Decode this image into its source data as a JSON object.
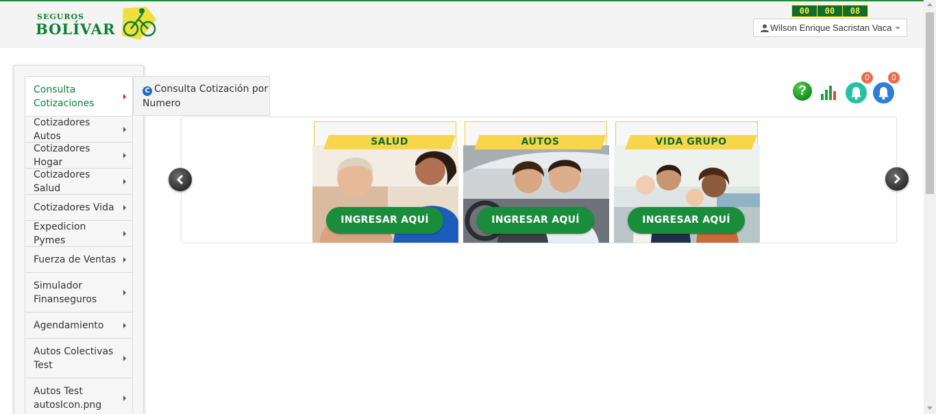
{
  "header": {
    "logo_small": "SEGUROS",
    "logo_big": "BOLÍVAR",
    "timer": [
      "00",
      "00",
      "08"
    ],
    "user_name": "Wilson Enrique Sacristan Vaca"
  },
  "colors": {
    "brand_green": "#0e7f37",
    "accent_yellow": "#f7d64a",
    "badge_orange": "#ee6a4d"
  },
  "sidebar": {
    "items": [
      {
        "label": "Consulta Cotizaciones",
        "active": true
      },
      {
        "label": "Cotizadores Autos"
      },
      {
        "label": "Cotizadores Hogar"
      },
      {
        "label": "Cotizadores Salud"
      },
      {
        "label": "Cotizadores Vida"
      },
      {
        "label": "Expedicion Pymes"
      },
      {
        "label": "Fuerza de Ventas"
      },
      {
        "label": "Simulador Finanseguros"
      },
      {
        "label": "Agendamiento"
      },
      {
        "label": "Autos Colectivas Test"
      },
      {
        "label": "Autos Test autosIcon.png"
      }
    ]
  },
  "submenu": {
    "icon_letter": "C",
    "label": "Consulta Cotización por Numero"
  },
  "toolbar": {
    "help_symbol": "?",
    "notifications_count": "0",
    "alerts_count": "0"
  },
  "carousel": {
    "cards": [
      {
        "title": "SALUD",
        "cta": "INGRESAR AQUÍ"
      },
      {
        "title": "AUTOS",
        "cta": "INGRESAR AQUÍ"
      },
      {
        "title": "VIDA GRUPO",
        "cta": "INGRESAR AQUÍ"
      }
    ]
  }
}
